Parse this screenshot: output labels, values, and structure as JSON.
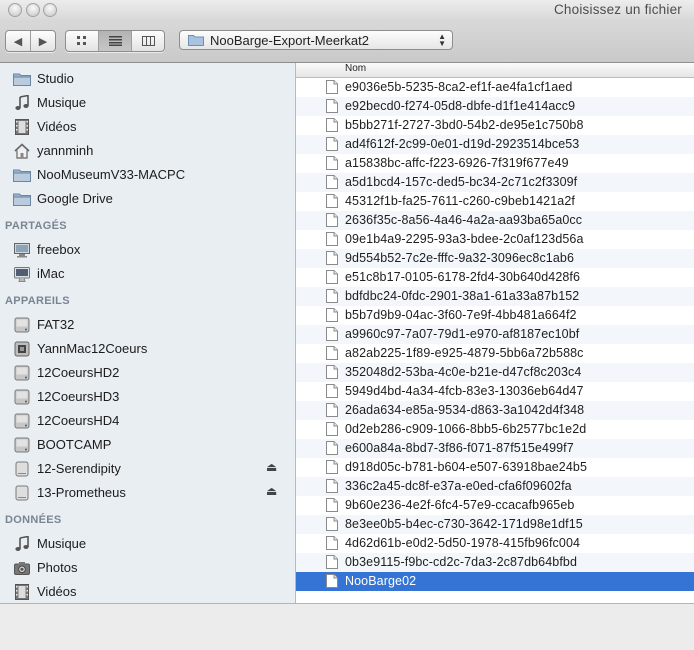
{
  "window": {
    "title": "Choisissez un fichier"
  },
  "toolbar": {
    "back": "◀",
    "forward": "▶",
    "location": "NooBarge-Export-Meerkat2"
  },
  "sidebar": {
    "favorites": [
      {
        "label": "Studio",
        "icon": "folder-icon"
      },
      {
        "label": "Musique",
        "icon": "music-note-icon"
      },
      {
        "label": "Vidéos",
        "icon": "film-icon"
      },
      {
        "label": "yannminh",
        "icon": "home-icon"
      },
      {
        "label": "NooMuseumV33-MACPC",
        "icon": "folder-icon"
      },
      {
        "label": "Google Drive",
        "icon": "folder-icon"
      }
    ],
    "shared_title": "PARTAGÉS",
    "shared": [
      {
        "label": "freebox",
        "icon": "monitor-icon"
      },
      {
        "label": "iMac",
        "icon": "imac-icon"
      }
    ],
    "devices_title": "APPAREILS",
    "devices": [
      {
        "label": "FAT32",
        "icon": "disk-icon",
        "eject": false
      },
      {
        "label": "YannMac12Coeurs",
        "icon": "computer-icon",
        "eject": false
      },
      {
        "label": "12CoeursHD2",
        "icon": "disk-icon",
        "eject": false
      },
      {
        "label": "12CoeursHD3",
        "icon": "disk-icon",
        "eject": false
      },
      {
        "label": "12CoeursHD4",
        "icon": "disk-icon",
        "eject": false
      },
      {
        "label": "BOOTCAMP",
        "icon": "disk-icon",
        "eject": false
      },
      {
        "label": "12-Serendipity",
        "icon": "external-disk-icon",
        "eject": true
      },
      {
        "label": "13-Prometheus",
        "icon": "external-disk-icon",
        "eject": true
      }
    ],
    "eject_glyph": "⏏",
    "data_title": "DONNÉES",
    "data": [
      {
        "label": "Musique",
        "icon": "music-note-icon"
      },
      {
        "label": "Photos",
        "icon": "camera-icon"
      },
      {
        "label": "Vidéos",
        "icon": "film-icon"
      }
    ]
  },
  "filelist": {
    "column_name": "Nom",
    "selected_index": 26,
    "files": [
      "e9036e5b-5235-8ca2-ef1f-ae4fa1cf1aed",
      "e92becd0-f274-05d8-dbfe-d1f1e414acc9",
      "b5bb271f-2727-3bd0-54b2-de95e1c750b8",
      "ad4f612f-2c99-0e01-d19d-2923514bce53",
      "a15838bc-affc-f223-6926-7f319f677e49",
      "a5d1bcd4-157c-ded5-bc34-2c71c2f3309f",
      "45312f1b-fa25-7611-c260-c9beb1421a2f",
      "2636f35c-8a56-4a46-4a2a-aa93ba65a0cc",
      "09e1b4a9-2295-93a3-bdee-2c0af123d56a",
      "9d554b52-7c2e-fffc-9a32-3096ec8c1ab6",
      "e51c8b17-0105-6178-2fd4-30b640d428f6",
      "bdfdbc24-0fdc-2901-38a1-61a33a87b152",
      "b5b7d9b9-04ac-3f60-7e9f-4bb481a664f2",
      "a9960c97-7a07-79d1-e970-af8187ec10bf",
      "a82ab225-1f89-e925-4879-5bb6a72b588c",
      "352048d2-53ba-4c0e-b21e-d47cf8c203c4",
      "5949d4bd-4a34-4fcb-83e3-13036eb64d47",
      "26ada634-e85a-9534-d863-3a1042d4f348",
      "0d2eb286-c909-1066-8bb5-6b2577bc1e2d",
      "e600a84a-8bd7-3f86-f071-87f515e499f7",
      "d918d05c-b781-b604-e507-63918bae24b5",
      "336c2a45-dc8f-e37a-e0ed-cfa6f09602fa",
      "9b60e236-4e2f-6fc4-57e9-ccacafb965eb",
      "8e3ee0b5-b4ec-c730-3642-171d98e1df15",
      "4d62d61b-e0d2-5d50-1978-415fb96fc004",
      "0b3e9115-f9bc-cd2c-7da3-2c87db64bfbd",
      "NooBarge02"
    ]
  },
  "colors": {
    "selection": "#3574d4",
    "sidebar_bg": "#e9eef3",
    "section_title": "#7a8592"
  }
}
